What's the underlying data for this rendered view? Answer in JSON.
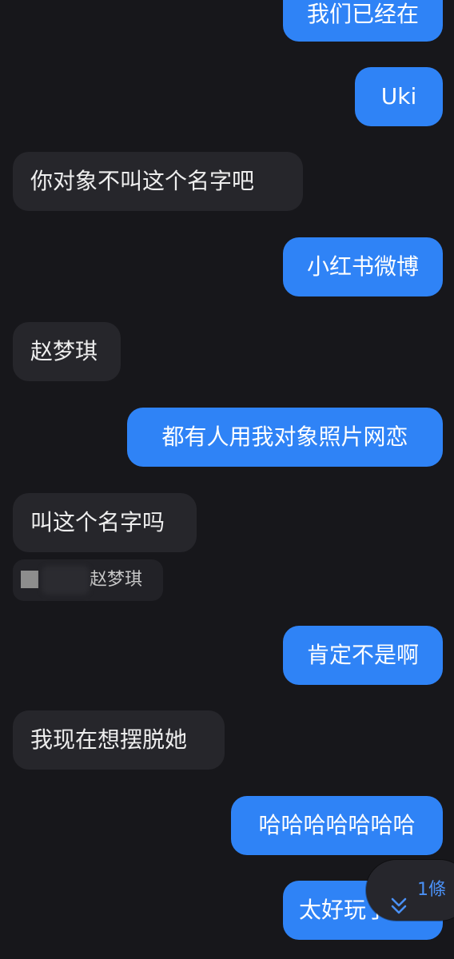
{
  "messages": [
    {
      "side": "out",
      "text": "我们已经在"
    },
    {
      "side": "out",
      "text": "Uki"
    },
    {
      "side": "in",
      "text": "你对象不叫这个名字吧"
    },
    {
      "side": "out",
      "text": "小红书微博"
    },
    {
      "side": "in",
      "text": "赵梦琪"
    },
    {
      "side": "out",
      "text": "都有人用我对象照片网恋"
    },
    {
      "side": "in",
      "text": "叫这个名字吗"
    },
    {
      "side": "out",
      "text": "肯定不是啊"
    },
    {
      "side": "in",
      "text": "我现在想摆脱她"
    },
    {
      "side": "out",
      "text": "哈哈哈哈哈哈哈"
    },
    {
      "side": "out",
      "text": "太好玩了"
    }
  ],
  "quoted_reply": {
    "text": "赵梦琪"
  },
  "new_messages_pill": {
    "icon": "double-chevron-down-icon",
    "label": "1條"
  },
  "colors": {
    "background": "#17171b",
    "outgoing_bubble": "#2f83f6",
    "incoming_bubble": "#26262b",
    "accent": "#4a90f5"
  }
}
